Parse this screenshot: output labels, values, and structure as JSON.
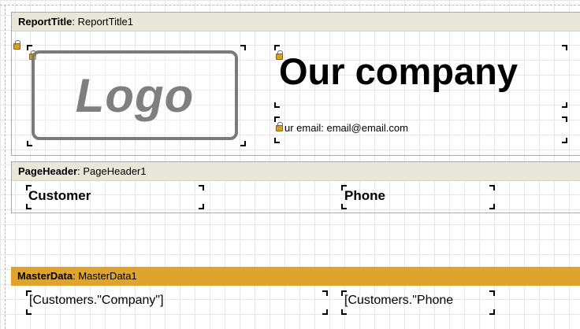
{
  "bands": {
    "report_title": {
      "type": "ReportTitle",
      "name": "ReportTitle1"
    },
    "page_header": {
      "type": "PageHeader",
      "name": "PageHeader1"
    },
    "master_data": {
      "type": "MasterData",
      "name": "MasterData1"
    }
  },
  "report_title": {
    "logo_text": "Logo",
    "company_name": "Our company",
    "email_text": "ur email: email@email.com"
  },
  "page_header": {
    "customer_label": "Customer",
    "phone_label": "Phone"
  },
  "master_data": {
    "company_field": "[Customers.\"Company\"]",
    "phone_field": "[Customers.\"Phone"
  },
  "colors": {
    "band_header": "#e9e7da",
    "master_data_header": "#e0a42c",
    "grid": "#e6e6e6"
  },
  "icons": [
    "lock-icon"
  ]
}
